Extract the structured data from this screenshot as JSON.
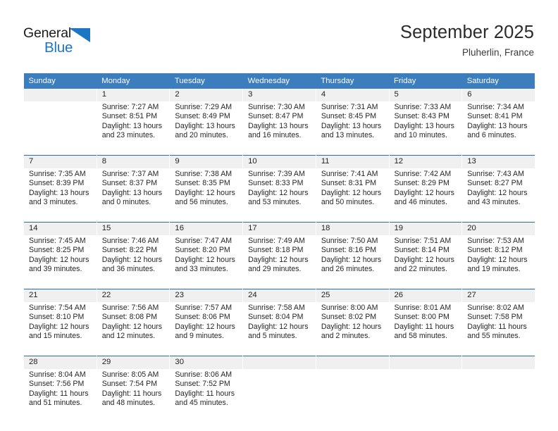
{
  "brand": {
    "name_part1": "General",
    "name_part2": "Blue",
    "triangle_color": "#1c76c4"
  },
  "header": {
    "title": "September 2025",
    "subtitle": "Pluherlin, France",
    "accent_color": "#3b7dbd"
  },
  "calendar": {
    "weekday_headers": [
      "Sunday",
      "Monday",
      "Tuesday",
      "Wednesday",
      "Thursday",
      "Friday",
      "Saturday"
    ],
    "weeks": [
      [
        {
          "day": "",
          "sunrise": "",
          "sunset": "",
          "daylight": "",
          "empty": true
        },
        {
          "day": "1",
          "sunrise": "Sunrise: 7:27 AM",
          "sunset": "Sunset: 8:51 PM",
          "daylight": "Daylight: 13 hours and 23 minutes."
        },
        {
          "day": "2",
          "sunrise": "Sunrise: 7:29 AM",
          "sunset": "Sunset: 8:49 PM",
          "daylight": "Daylight: 13 hours and 20 minutes."
        },
        {
          "day": "3",
          "sunrise": "Sunrise: 7:30 AM",
          "sunset": "Sunset: 8:47 PM",
          "daylight": "Daylight: 13 hours and 16 minutes."
        },
        {
          "day": "4",
          "sunrise": "Sunrise: 7:31 AM",
          "sunset": "Sunset: 8:45 PM",
          "daylight": "Daylight: 13 hours and 13 minutes."
        },
        {
          "day": "5",
          "sunrise": "Sunrise: 7:33 AM",
          "sunset": "Sunset: 8:43 PM",
          "daylight": "Daylight: 13 hours and 10 minutes."
        },
        {
          "day": "6",
          "sunrise": "Sunrise: 7:34 AM",
          "sunset": "Sunset: 8:41 PM",
          "daylight": "Daylight: 13 hours and 6 minutes."
        }
      ],
      [
        {
          "day": "7",
          "sunrise": "Sunrise: 7:35 AM",
          "sunset": "Sunset: 8:39 PM",
          "daylight": "Daylight: 13 hours and 3 minutes."
        },
        {
          "day": "8",
          "sunrise": "Sunrise: 7:37 AM",
          "sunset": "Sunset: 8:37 PM",
          "daylight": "Daylight: 13 hours and 0 minutes."
        },
        {
          "day": "9",
          "sunrise": "Sunrise: 7:38 AM",
          "sunset": "Sunset: 8:35 PM",
          "daylight": "Daylight: 12 hours and 56 minutes."
        },
        {
          "day": "10",
          "sunrise": "Sunrise: 7:39 AM",
          "sunset": "Sunset: 8:33 PM",
          "daylight": "Daylight: 12 hours and 53 minutes."
        },
        {
          "day": "11",
          "sunrise": "Sunrise: 7:41 AM",
          "sunset": "Sunset: 8:31 PM",
          "daylight": "Daylight: 12 hours and 50 minutes."
        },
        {
          "day": "12",
          "sunrise": "Sunrise: 7:42 AM",
          "sunset": "Sunset: 8:29 PM",
          "daylight": "Daylight: 12 hours and 46 minutes."
        },
        {
          "day": "13",
          "sunrise": "Sunrise: 7:43 AM",
          "sunset": "Sunset: 8:27 PM",
          "daylight": "Daylight: 12 hours and 43 minutes."
        }
      ],
      [
        {
          "day": "14",
          "sunrise": "Sunrise: 7:45 AM",
          "sunset": "Sunset: 8:25 PM",
          "daylight": "Daylight: 12 hours and 39 minutes."
        },
        {
          "day": "15",
          "sunrise": "Sunrise: 7:46 AM",
          "sunset": "Sunset: 8:22 PM",
          "daylight": "Daylight: 12 hours and 36 minutes."
        },
        {
          "day": "16",
          "sunrise": "Sunrise: 7:47 AM",
          "sunset": "Sunset: 8:20 PM",
          "daylight": "Daylight: 12 hours and 33 minutes."
        },
        {
          "day": "17",
          "sunrise": "Sunrise: 7:49 AM",
          "sunset": "Sunset: 8:18 PM",
          "daylight": "Daylight: 12 hours and 29 minutes."
        },
        {
          "day": "18",
          "sunrise": "Sunrise: 7:50 AM",
          "sunset": "Sunset: 8:16 PM",
          "daylight": "Daylight: 12 hours and 26 minutes."
        },
        {
          "day": "19",
          "sunrise": "Sunrise: 7:51 AM",
          "sunset": "Sunset: 8:14 PM",
          "daylight": "Daylight: 12 hours and 22 minutes."
        },
        {
          "day": "20",
          "sunrise": "Sunrise: 7:53 AM",
          "sunset": "Sunset: 8:12 PM",
          "daylight": "Daylight: 12 hours and 19 minutes."
        }
      ],
      [
        {
          "day": "21",
          "sunrise": "Sunrise: 7:54 AM",
          "sunset": "Sunset: 8:10 PM",
          "daylight": "Daylight: 12 hours and 15 minutes."
        },
        {
          "day": "22",
          "sunrise": "Sunrise: 7:56 AM",
          "sunset": "Sunset: 8:08 PM",
          "daylight": "Daylight: 12 hours and 12 minutes."
        },
        {
          "day": "23",
          "sunrise": "Sunrise: 7:57 AM",
          "sunset": "Sunset: 8:06 PM",
          "daylight": "Daylight: 12 hours and 9 minutes."
        },
        {
          "day": "24",
          "sunrise": "Sunrise: 7:58 AM",
          "sunset": "Sunset: 8:04 PM",
          "daylight": "Daylight: 12 hours and 5 minutes."
        },
        {
          "day": "25",
          "sunrise": "Sunrise: 8:00 AM",
          "sunset": "Sunset: 8:02 PM",
          "daylight": "Daylight: 12 hours and 2 minutes."
        },
        {
          "day": "26",
          "sunrise": "Sunrise: 8:01 AM",
          "sunset": "Sunset: 8:00 PM",
          "daylight": "Daylight: 11 hours and 58 minutes."
        },
        {
          "day": "27",
          "sunrise": "Sunrise: 8:02 AM",
          "sunset": "Sunset: 7:58 PM",
          "daylight": "Daylight: 11 hours and 55 minutes."
        }
      ],
      [
        {
          "day": "28",
          "sunrise": "Sunrise: 8:04 AM",
          "sunset": "Sunset: 7:56 PM",
          "daylight": "Daylight: 11 hours and 51 minutes."
        },
        {
          "day": "29",
          "sunrise": "Sunrise: 8:05 AM",
          "sunset": "Sunset: 7:54 PM",
          "daylight": "Daylight: 11 hours and 48 minutes."
        },
        {
          "day": "30",
          "sunrise": "Sunrise: 8:06 AM",
          "sunset": "Sunset: 7:52 PM",
          "daylight": "Daylight: 11 hours and 45 minutes."
        },
        {
          "day": "",
          "sunrise": "",
          "sunset": "",
          "daylight": "",
          "empty": true
        },
        {
          "day": "",
          "sunrise": "",
          "sunset": "",
          "daylight": "",
          "empty": true
        },
        {
          "day": "",
          "sunrise": "",
          "sunset": "",
          "daylight": "",
          "empty": true
        },
        {
          "day": "",
          "sunrise": "",
          "sunset": "",
          "daylight": "",
          "empty": true
        }
      ]
    ]
  }
}
